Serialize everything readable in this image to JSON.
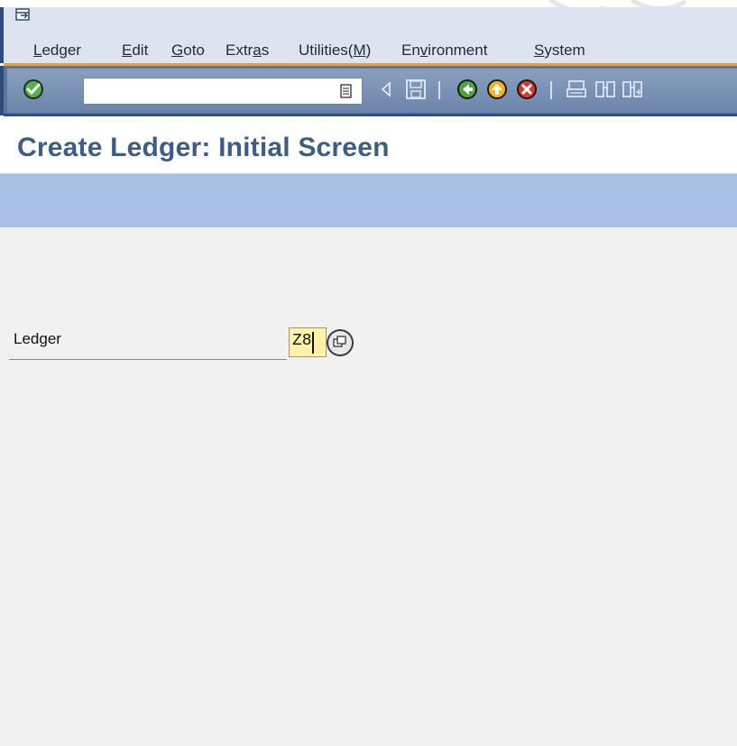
{
  "menu": {
    "items": [
      {
        "pre": "",
        "u": "L",
        "post": "edger"
      },
      {
        "pre": "",
        "u": "E",
        "post": "dit"
      },
      {
        "pre": "",
        "u": "G",
        "post": "oto"
      },
      {
        "pre": "Extr",
        "u": "a",
        "post": "s"
      },
      {
        "pre": "Utilities(",
        "u": "M",
        "post": ")"
      },
      {
        "pre": "En",
        "u": "v",
        "post": "ironment"
      },
      {
        "pre": "",
        "u": "S",
        "post": "ystem"
      }
    ]
  },
  "toolbar": {
    "command_value": "",
    "icons": [
      "enter-icon",
      "command-doc-icon",
      "back-arrow-small-icon",
      "save-icon",
      "back-icon",
      "exit-icon",
      "cancel-icon",
      "print-icon",
      "find-icon",
      "find-next-icon"
    ]
  },
  "title": "Create Ledger: Initial Screen",
  "form": {
    "ledger_label": "Ledger",
    "ledger_value": "Z8"
  },
  "colors": {
    "title": "#3c5d85",
    "app_band": "#a7c0e3",
    "content_bg": "#f1f1f1",
    "input_highlight": "#fff2a8",
    "separator": "#e8a030"
  }
}
